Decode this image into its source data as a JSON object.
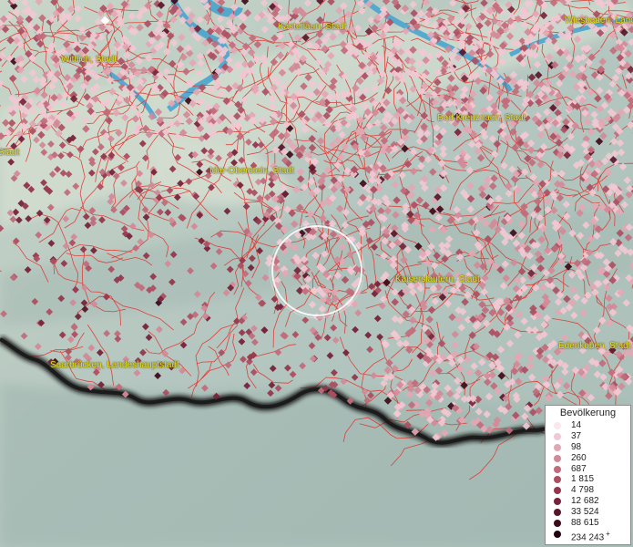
{
  "map": {
    "labels": [
      {
        "id": "kastellaun",
        "text": "Kastellaun, Stadt"
      },
      {
        "id": "wiesbaden",
        "text": "Wiesbaden, Landeshauptstadt"
      },
      {
        "id": "wittlich",
        "text": "Wittlich, Stadt"
      },
      {
        "id": "bad-kreuznach",
        "text": "Bad Kreuznach, Stadt"
      },
      {
        "id": "trier",
        "text": "Stadt"
      },
      {
        "id": "idar-oberstein",
        "text": "Idar-Oberstein, Stadt"
      },
      {
        "id": "kaiserslautern",
        "text": "Kaiserslautern, Stadt"
      },
      {
        "id": "edenkoben",
        "text": "Edenkoben, Stadt"
      },
      {
        "id": "saarbruecken",
        "text": "Saarbrücken, Landeshauptstadt"
      }
    ],
    "colors": {
      "terrain": "#b7c8c3",
      "boundary": "#e2332f",
      "water": "#3a9fd0",
      "border_line": "#141414",
      "label": "#e8e21a"
    }
  },
  "legend": {
    "title": "Bevölkerung",
    "items": [
      {
        "label": "14",
        "color": "#fbe7ee"
      },
      {
        "label": "37",
        "color": "#f1c8d3"
      },
      {
        "label": "98",
        "color": "#e3a7b4"
      },
      {
        "label": "260",
        "color": "#d28a98"
      },
      {
        "label": "687",
        "color": "#c16b7b"
      },
      {
        "label": "1 815",
        "color": "#ad4f62"
      },
      {
        "label": "4 798",
        "color": "#93384c"
      },
      {
        "label": "12 682",
        "color": "#76243a"
      },
      {
        "label": "33 524",
        "color": "#591629"
      },
      {
        "label": "88 615",
        "color": "#3d0b1a"
      },
      {
        "label": "234 243",
        "color": "#24050e",
        "plus": "+"
      }
    ]
  }
}
